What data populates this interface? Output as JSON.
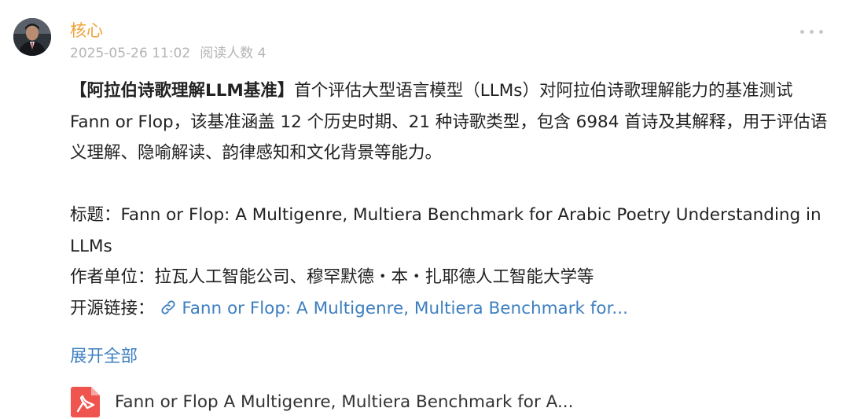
{
  "post": {
    "author": "核心",
    "date": "2025-05-26 11:02",
    "views": "阅读人数 4",
    "headline": "【阿拉伯诗歌理解LLM基准】",
    "intro": "首个评估大型语言模型（LLMs）对阿拉伯诗歌理解能力的基准测试 Fann or Flop，该基准涵盖 12 个历史时期、21 种诗歌类型，包含 6984 首诗及其解释，用于评估语义理解、隐喻解读、韵律感知和文化背景等能力。",
    "title_line": "标题：Fann or Flop: A Multigenre, Multiera Benchmark for Arabic Poetry Understanding in LLMs",
    "affiliation_line": "作者单位：拉瓦人工智能公司、穆罕默德・本・扎耶德人工智能大学等",
    "opensource_label": "开源链接：",
    "opensource_link_text": "Fann or Flop: A Multigenre, Multiera Benchmark for...",
    "expand_label": "展开全部",
    "attachment_name": "Fann or Flop A Multigenre, Multiera Benchmark for A..."
  },
  "icons": {
    "more": "more-dots-icon",
    "link": "link-icon",
    "pdf": "pdf-file-icon"
  },
  "colors": {
    "author": "#f0a23a",
    "meta": "#b4b4b4",
    "link": "#3d7fc1",
    "text": "#222222",
    "pdf": "#f0544f"
  }
}
